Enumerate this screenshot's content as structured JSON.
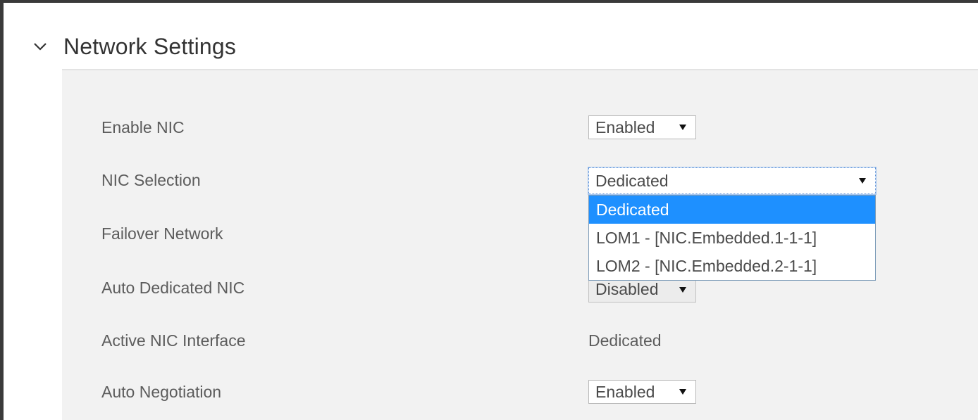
{
  "section": {
    "title": "Network Settings",
    "toggle_icon": "chevron-down-icon"
  },
  "settings": {
    "enable_nic": {
      "label": "Enable NIC",
      "value": "Enabled"
    },
    "nic_selection": {
      "label": "NIC Selection",
      "value": "Dedicated",
      "options": [
        "Dedicated",
        "LOM1 - [NIC.Embedded.1-1-1]",
        "LOM2 - [NIC.Embedded.2-1-1]"
      ],
      "highlighted_option": "Dedicated"
    },
    "failover_network": {
      "label": "Failover Network"
    },
    "auto_dedicated_nic": {
      "label": "Auto Dedicated NIC",
      "value": "Disabled"
    },
    "active_nic_interface": {
      "label": "Active NIC Interface",
      "value": "Dedicated"
    },
    "auto_negotiation": {
      "label": "Auto Negotiation",
      "value": "Enabled"
    }
  },
  "colors": {
    "panel_background": "#f2f2f2",
    "highlight": "#1e90ff",
    "frame_border": "#3a3a3a"
  }
}
